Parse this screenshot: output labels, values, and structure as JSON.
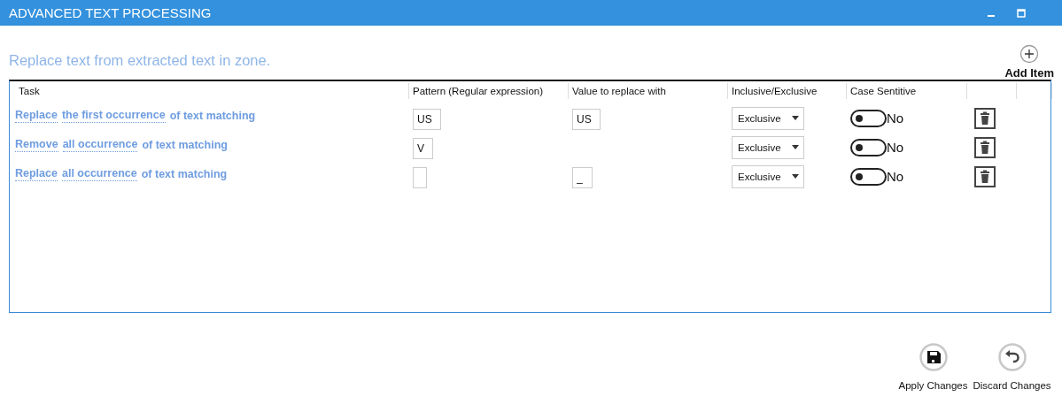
{
  "window": {
    "title": "ADVANCED TEXT PROCESSING"
  },
  "subtitle": "Replace text from extracted text in zone.",
  "add_item": {
    "label": "Add Item"
  },
  "table": {
    "columns": [
      "Task",
      "Pattern (Regular expression)",
      "Value to replace with",
      "Inclusive/Exclusive",
      "Case Sentitive"
    ],
    "rows": [
      {
        "task": [
          {
            "text": "Replace",
            "kind": "link"
          },
          {
            "text": "the first occurrence",
            "kind": "link"
          },
          {
            "text": "of text matching",
            "kind": "plain"
          }
        ],
        "pattern": "US",
        "value": "US",
        "mode": "Exclusive",
        "case_sensitive": {
          "on": false,
          "label": "No"
        }
      },
      {
        "task": [
          {
            "text": "Remove",
            "kind": "link"
          },
          {
            "text": "all occurrence",
            "kind": "link"
          },
          {
            "text": "of text matching",
            "kind": "plain"
          }
        ],
        "pattern": "V",
        "mode": "Exclusive",
        "case_sensitive": {
          "on": false,
          "label": "No"
        }
      },
      {
        "task": [
          {
            "text": "Replace",
            "kind": "link"
          },
          {
            "text": "all occurrence",
            "kind": "link"
          },
          {
            "text": "of text matching",
            "kind": "plain"
          }
        ],
        "pattern": "",
        "value": "_",
        "mode": "Exclusive",
        "case_sensitive": {
          "on": false,
          "label": "No"
        }
      }
    ]
  },
  "buttons": [
    {
      "label": "Apply Changes",
      "kind": "save"
    },
    {
      "label": "Discard Changes",
      "kind": "undo"
    }
  ]
}
